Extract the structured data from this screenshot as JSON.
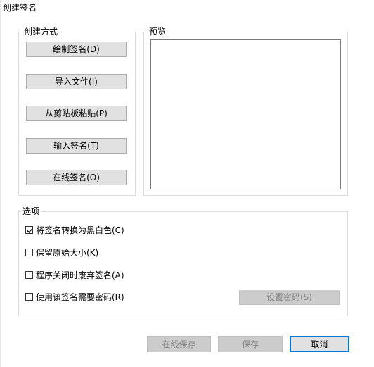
{
  "window": {
    "title": "创建签名"
  },
  "create_method": {
    "label": "创建方式",
    "buttons": [
      "绘制签名(D)",
      "导入文件(I)",
      "从剪贴板粘贴(P)",
      "输入签名(T)",
      "在线签名(O)"
    ]
  },
  "preview": {
    "label": "预览"
  },
  "options": {
    "label": "选项",
    "items": [
      {
        "label": "将签名转换为黑白色(C)",
        "checked": true
      },
      {
        "label": "保留原始大小(K)",
        "checked": false
      },
      {
        "label": "程序关闭时废弃签名(A)",
        "checked": false
      },
      {
        "label": "使用该签名需要密码(R)",
        "checked": false
      }
    ],
    "set_password_label": "设置密码(S)"
  },
  "footer": {
    "online_save_label": "在线保存",
    "save_label": "保存",
    "cancel_label": "取消"
  }
}
